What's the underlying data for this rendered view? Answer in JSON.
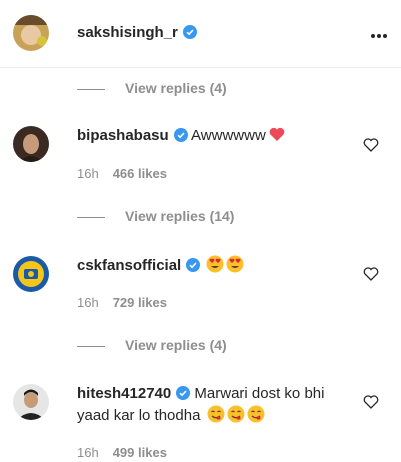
{
  "post_header": {
    "username": "sakshisingh_r",
    "verified_icon": "verified-badge-icon",
    "more_icon": "more-options-icon"
  },
  "view_replies": [
    {
      "label": "View replies (4)"
    },
    {
      "label": "View replies (14)"
    },
    {
      "label": "View replies (4)"
    }
  ],
  "comments": [
    {
      "username": "bipashabasu",
      "text": "Awwwwww",
      "emoji": "red-heart",
      "time": "16h",
      "likes": "466 likes"
    },
    {
      "username": "cskfansofficial",
      "text": "",
      "emoji": "heart-eyes x2",
      "time": "16h",
      "likes": "729 likes"
    },
    {
      "username": "hitesh412740",
      "text": "Marwari dost ko bhi yaad kar lo thodha",
      "emoji": "yum-face x3",
      "time": "16h",
      "likes": "499 likes"
    }
  ],
  "colors": {
    "accent": "#3897f0",
    "muted": "#8e8e8e",
    "text": "#262626",
    "heart_red": "#ed4956"
  }
}
